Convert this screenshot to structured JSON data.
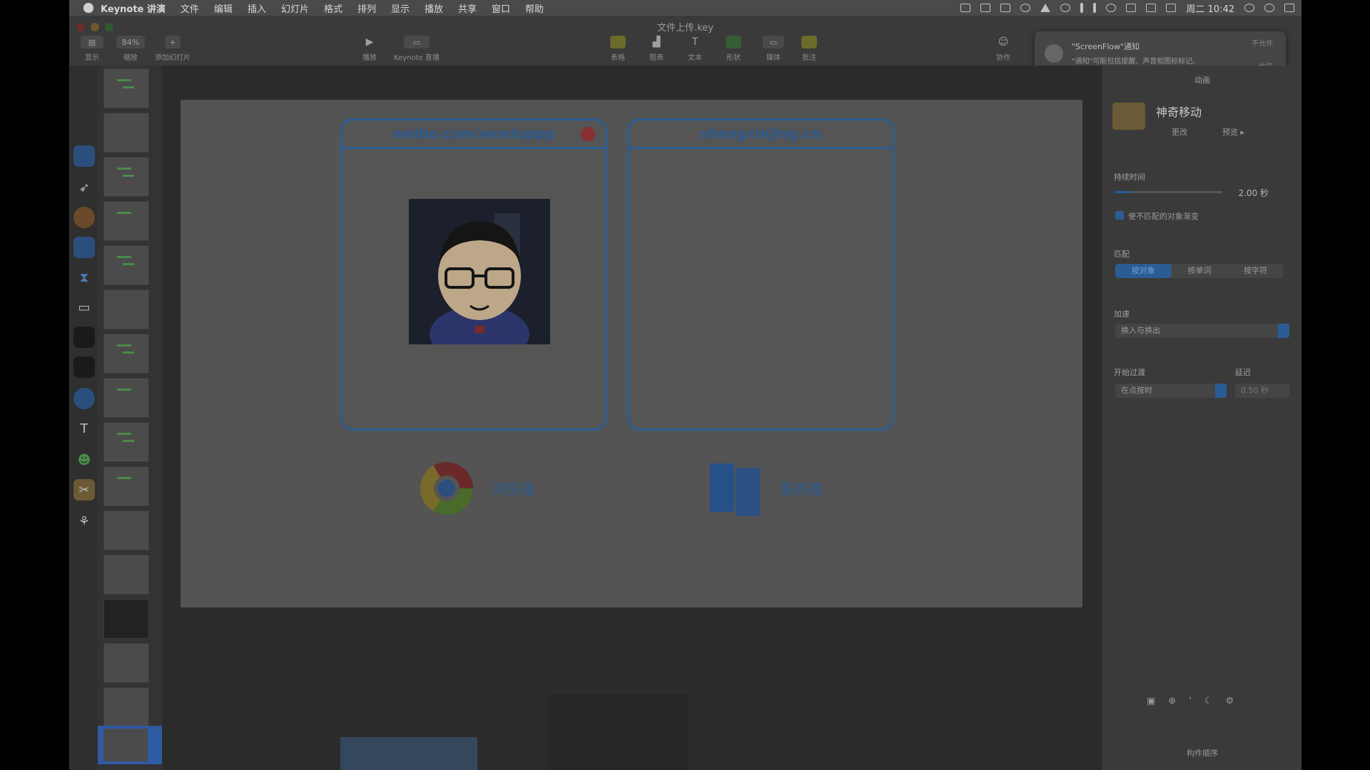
{
  "menubar": {
    "app_name": "Keynote 讲演",
    "items": [
      "文件",
      "编辑",
      "插入",
      "幻灯片",
      "格式",
      "排列",
      "显示",
      "播放",
      "共享",
      "窗口",
      "帮助"
    ],
    "clock": "周二 10:42"
  },
  "window": {
    "title": "文件上传.key"
  },
  "toolbar": {
    "view_label": "显示",
    "zoom_value": "84%",
    "zoom_label": "缩放",
    "add_slide_label": "添加幻灯片",
    "play_label": "播放",
    "keynote_live_label": "Keynote 直播",
    "table_label": "表格",
    "chart_label": "图表",
    "text_label": "文本",
    "shape_label": "形状",
    "media_label": "媒体",
    "comment_label": "批注",
    "collab_label": "协作"
  },
  "notification": {
    "title": "\"ScreenFlow\"通知",
    "body": "\"通知\"可能包括提醒、声音和图标标记。",
    "button_1": "不允许",
    "button_2": "允许"
  },
  "slide": {
    "card_left_title": "weibo.com/woniuppp",
    "card_right_title": "shengxinjing.cn",
    "browser_label": "浏览器",
    "server_label": "服务器"
  },
  "inspector": {
    "top_label": "动画",
    "effect_name": "神奇移动",
    "change_label": "更改",
    "preview_label": "预览",
    "duration_label": "持续时间",
    "duration_value": "2.00 秒",
    "duration_fraction": 0.16,
    "fade_label": "使不匹配的对象渐变",
    "fade_checked": true,
    "match_label": "匹配",
    "match_options": [
      "按对象",
      "按单词",
      "按字符"
    ],
    "match_selected": "按对象",
    "accel_label": "加速",
    "accel_value": "换入与换出",
    "start_label": "开始过渡",
    "start_value": "在点按时",
    "delay_label": "延迟",
    "delay_value": "0.50 秒",
    "build_order_label": "构件顺序"
  },
  "navigator": {
    "selected_slide_number": "22"
  },
  "colors": {
    "accent": "#2b5d95",
    "card_border": "#2b5d95"
  }
}
